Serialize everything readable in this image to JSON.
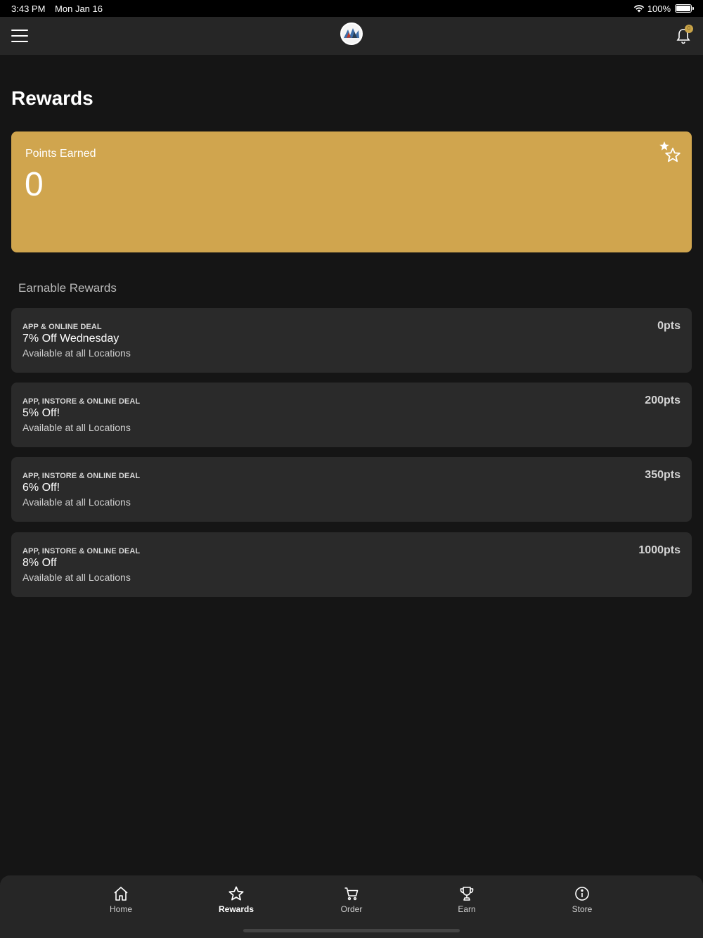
{
  "status_bar": {
    "time": "3:43 PM",
    "date": "Mon Jan 16",
    "battery": "100%"
  },
  "header": {
    "menu_icon": "hamburger-icon",
    "logo_icon": "brand-logo",
    "bell_icon": "bell-icon",
    "bell_badge": "0"
  },
  "page": {
    "title": "Rewards"
  },
  "points_card": {
    "label": "Points Earned",
    "value": "0",
    "icon": "stars-icon",
    "color": "#d0a54e"
  },
  "earnable": {
    "section_title": "Earnable Rewards",
    "rewards": [
      {
        "tag": "APP & ONLINE DEAL",
        "name": "7% Off Wednesday",
        "availability": "Available at all Locations",
        "points": "0pts"
      },
      {
        "tag": "APP, INSTORE & ONLINE DEAL",
        "name": "5% Off!",
        "availability": "Available at all Locations",
        "points": "200pts"
      },
      {
        "tag": "APP, INSTORE & ONLINE DEAL",
        "name": "6% Off!",
        "availability": "Available at all Locations",
        "points": "350pts"
      },
      {
        "tag": "APP, INSTORE & ONLINE DEAL",
        "name": "8% Off",
        "availability": "Available at all Locations",
        "points": "1000pts"
      }
    ]
  },
  "tab_bar": {
    "tabs": [
      {
        "label": "Home",
        "icon": "home-icon"
      },
      {
        "label": "Rewards",
        "icon": "star-icon",
        "active": true
      },
      {
        "label": "Order",
        "icon": "cart-icon"
      },
      {
        "label": "Earn",
        "icon": "trophy-icon"
      },
      {
        "label": "Store",
        "icon": "info-icon"
      }
    ]
  }
}
